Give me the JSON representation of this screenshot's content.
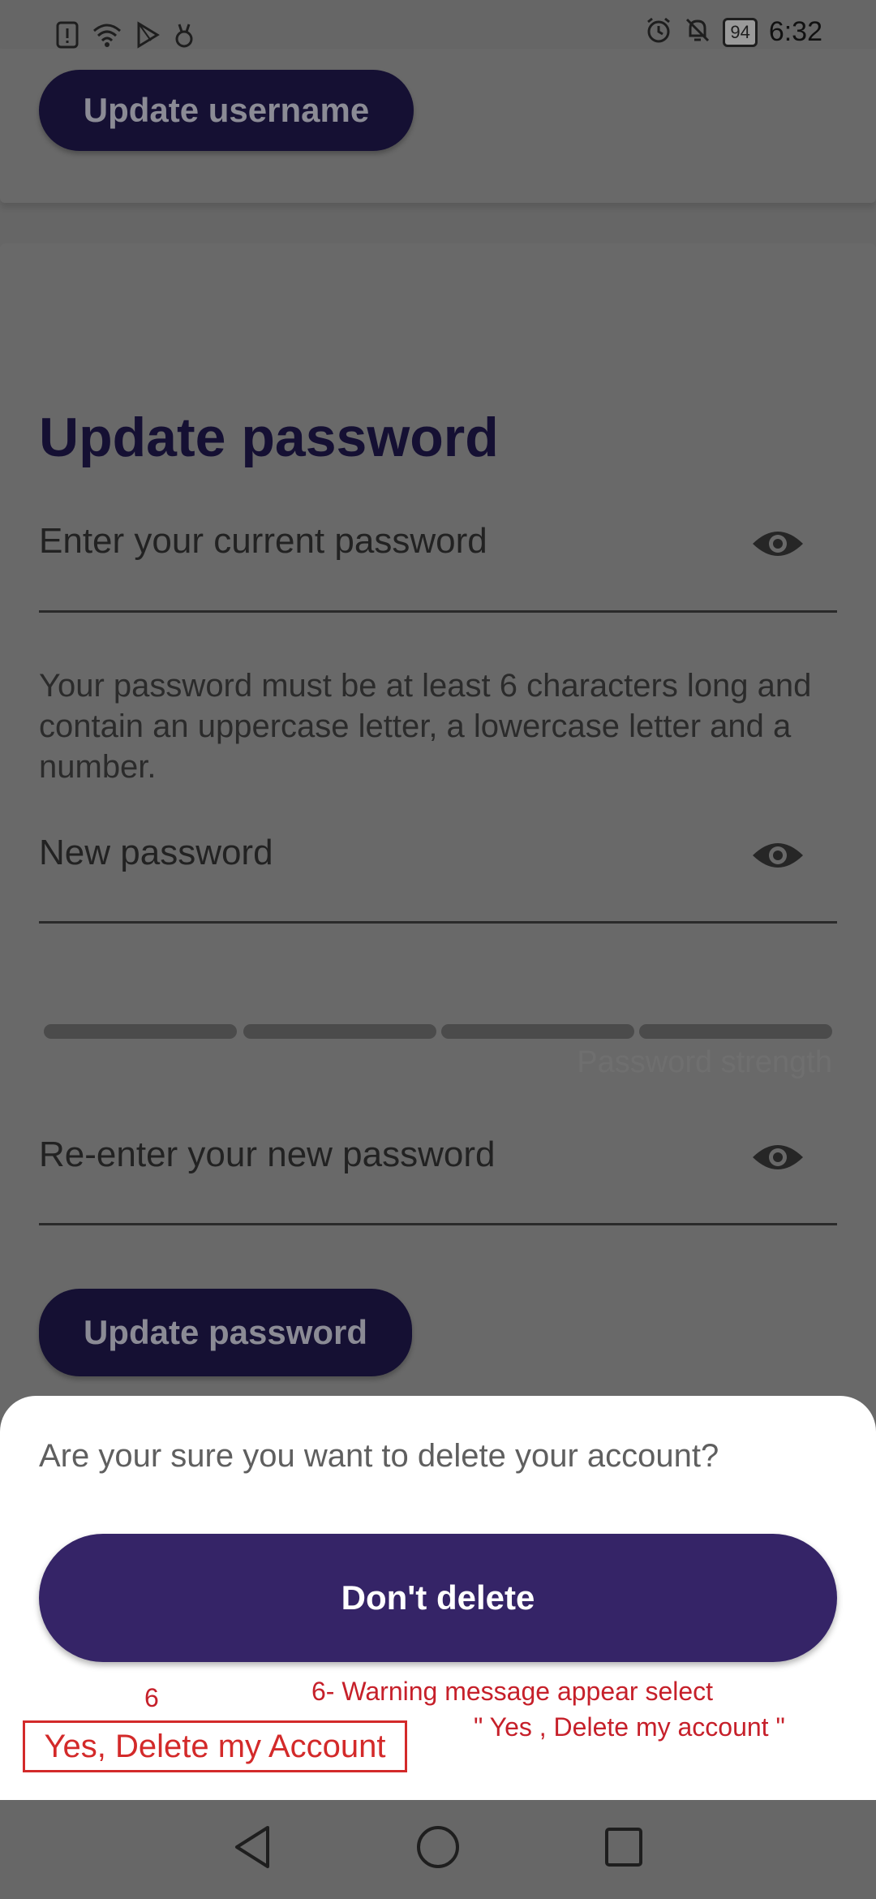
{
  "status_bar": {
    "time": "6:32",
    "battery": "94",
    "left_icons": [
      "sim-alert-icon",
      "wifi-icon",
      "play-icon",
      "bug-icon"
    ],
    "right_icons": [
      "alarm-icon",
      "bell-off-icon",
      "battery-icon"
    ]
  },
  "username_section": {
    "update_button": "Update username"
  },
  "password_section": {
    "title": "Update password",
    "current_password_placeholder": "Enter your current password",
    "hint": "Your password must be at least 6 characters long and contain an uppercase letter, a lowercase letter and a number.",
    "new_password_placeholder": "New password",
    "strength_label": "Password strength",
    "strength_segments": 4,
    "reenter_placeholder": "Re-enter your new password",
    "update_button": "Update password"
  },
  "delete_sheet": {
    "question": "Are your sure you want to delete your account?",
    "dont_delete_button": "Don't delete",
    "confirm_button": "Yes, Delete my Account"
  },
  "annotation": {
    "step_number": "6",
    "line1": "6- Warning message appear select",
    "line2": "\" Yes ,  Delete my account \""
  },
  "colors": {
    "dim_overlay": "#666666",
    "primary_dark": "#151033",
    "primary": "#352467",
    "annotation_red": "#d32a2a"
  }
}
